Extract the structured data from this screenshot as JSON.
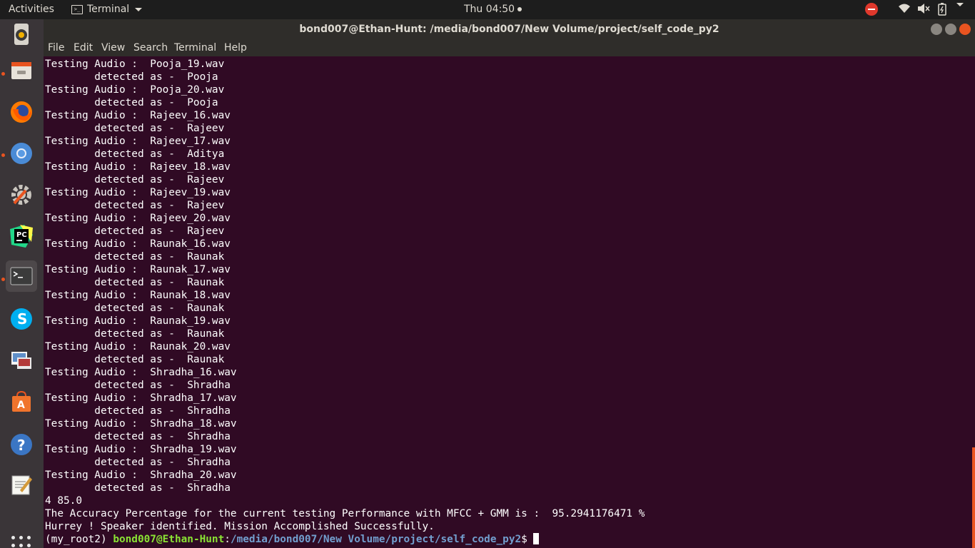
{
  "topbar": {
    "activities": "Activities",
    "app_name": "Terminal",
    "clock": "Thu 04:50"
  },
  "launcher": {
    "items": [
      "rhythmbox",
      "files",
      "firefox",
      "chromium",
      "settings",
      "pycharm",
      "terminal",
      "skype",
      "image-viewer",
      "software-center",
      "help",
      "text-editor"
    ]
  },
  "window": {
    "title": "bond007@Ethan-Hunt: /media/bond007/New Volume/project/self_code_py2",
    "menu": [
      "File",
      "Edit",
      "View",
      "Search",
      "Terminal",
      "Help"
    ]
  },
  "terminal": {
    "lines": [
      "Testing Audio :  Pooja_19.wav",
      "        detected as -  Pooja",
      "Testing Audio :  Pooja_20.wav",
      "        detected as -  Pooja",
      "Testing Audio :  Rajeev_16.wav",
      "        detected as -  Rajeev",
      "Testing Audio :  Rajeev_17.wav",
      "        detected as -  Aditya",
      "Testing Audio :  Rajeev_18.wav",
      "        detected as -  Rajeev",
      "Testing Audio :  Rajeev_19.wav",
      "        detected as -  Rajeev",
      "Testing Audio :  Rajeev_20.wav",
      "        detected as -  Rajeev",
      "Testing Audio :  Raunak_16.wav",
      "        detected as -  Raunak",
      "Testing Audio :  Raunak_17.wav",
      "        detected as -  Raunak",
      "Testing Audio :  Raunak_18.wav",
      "        detected as -  Raunak",
      "Testing Audio :  Raunak_19.wav",
      "        detected as -  Raunak",
      "Testing Audio :  Raunak_20.wav",
      "        detected as -  Raunak",
      "Testing Audio :  Shradha_16.wav",
      "        detected as -  Shradha",
      "Testing Audio :  Shradha_17.wav",
      "        detected as -  Shradha",
      "Testing Audio :  Shradha_18.wav",
      "        detected as -  Shradha",
      "Testing Audio :  Shradha_19.wav",
      "        detected as -  Shradha",
      "Testing Audio :  Shradha_20.wav",
      "        detected as -  Shradha",
      "4 85.0",
      "The Accuracy Percentage for the current testing Performance with MFCC + GMM is :  95.2941176471 %",
      "Hurrey ! Speaker identified. Mission Accomplished Successfully."
    ],
    "prompt_env": "(my_root2) ",
    "prompt_user": "bond007@Ethan-Hunt",
    "prompt_sep": ":",
    "prompt_path": "/media/bond007/New Volume/project/self_code_py2",
    "prompt_symbol": "$ "
  },
  "colors": {
    "terminal_bg": "#300a24",
    "accent": "#e95420",
    "prompt_user": "#8ae234",
    "prompt_path": "#729fcf"
  }
}
